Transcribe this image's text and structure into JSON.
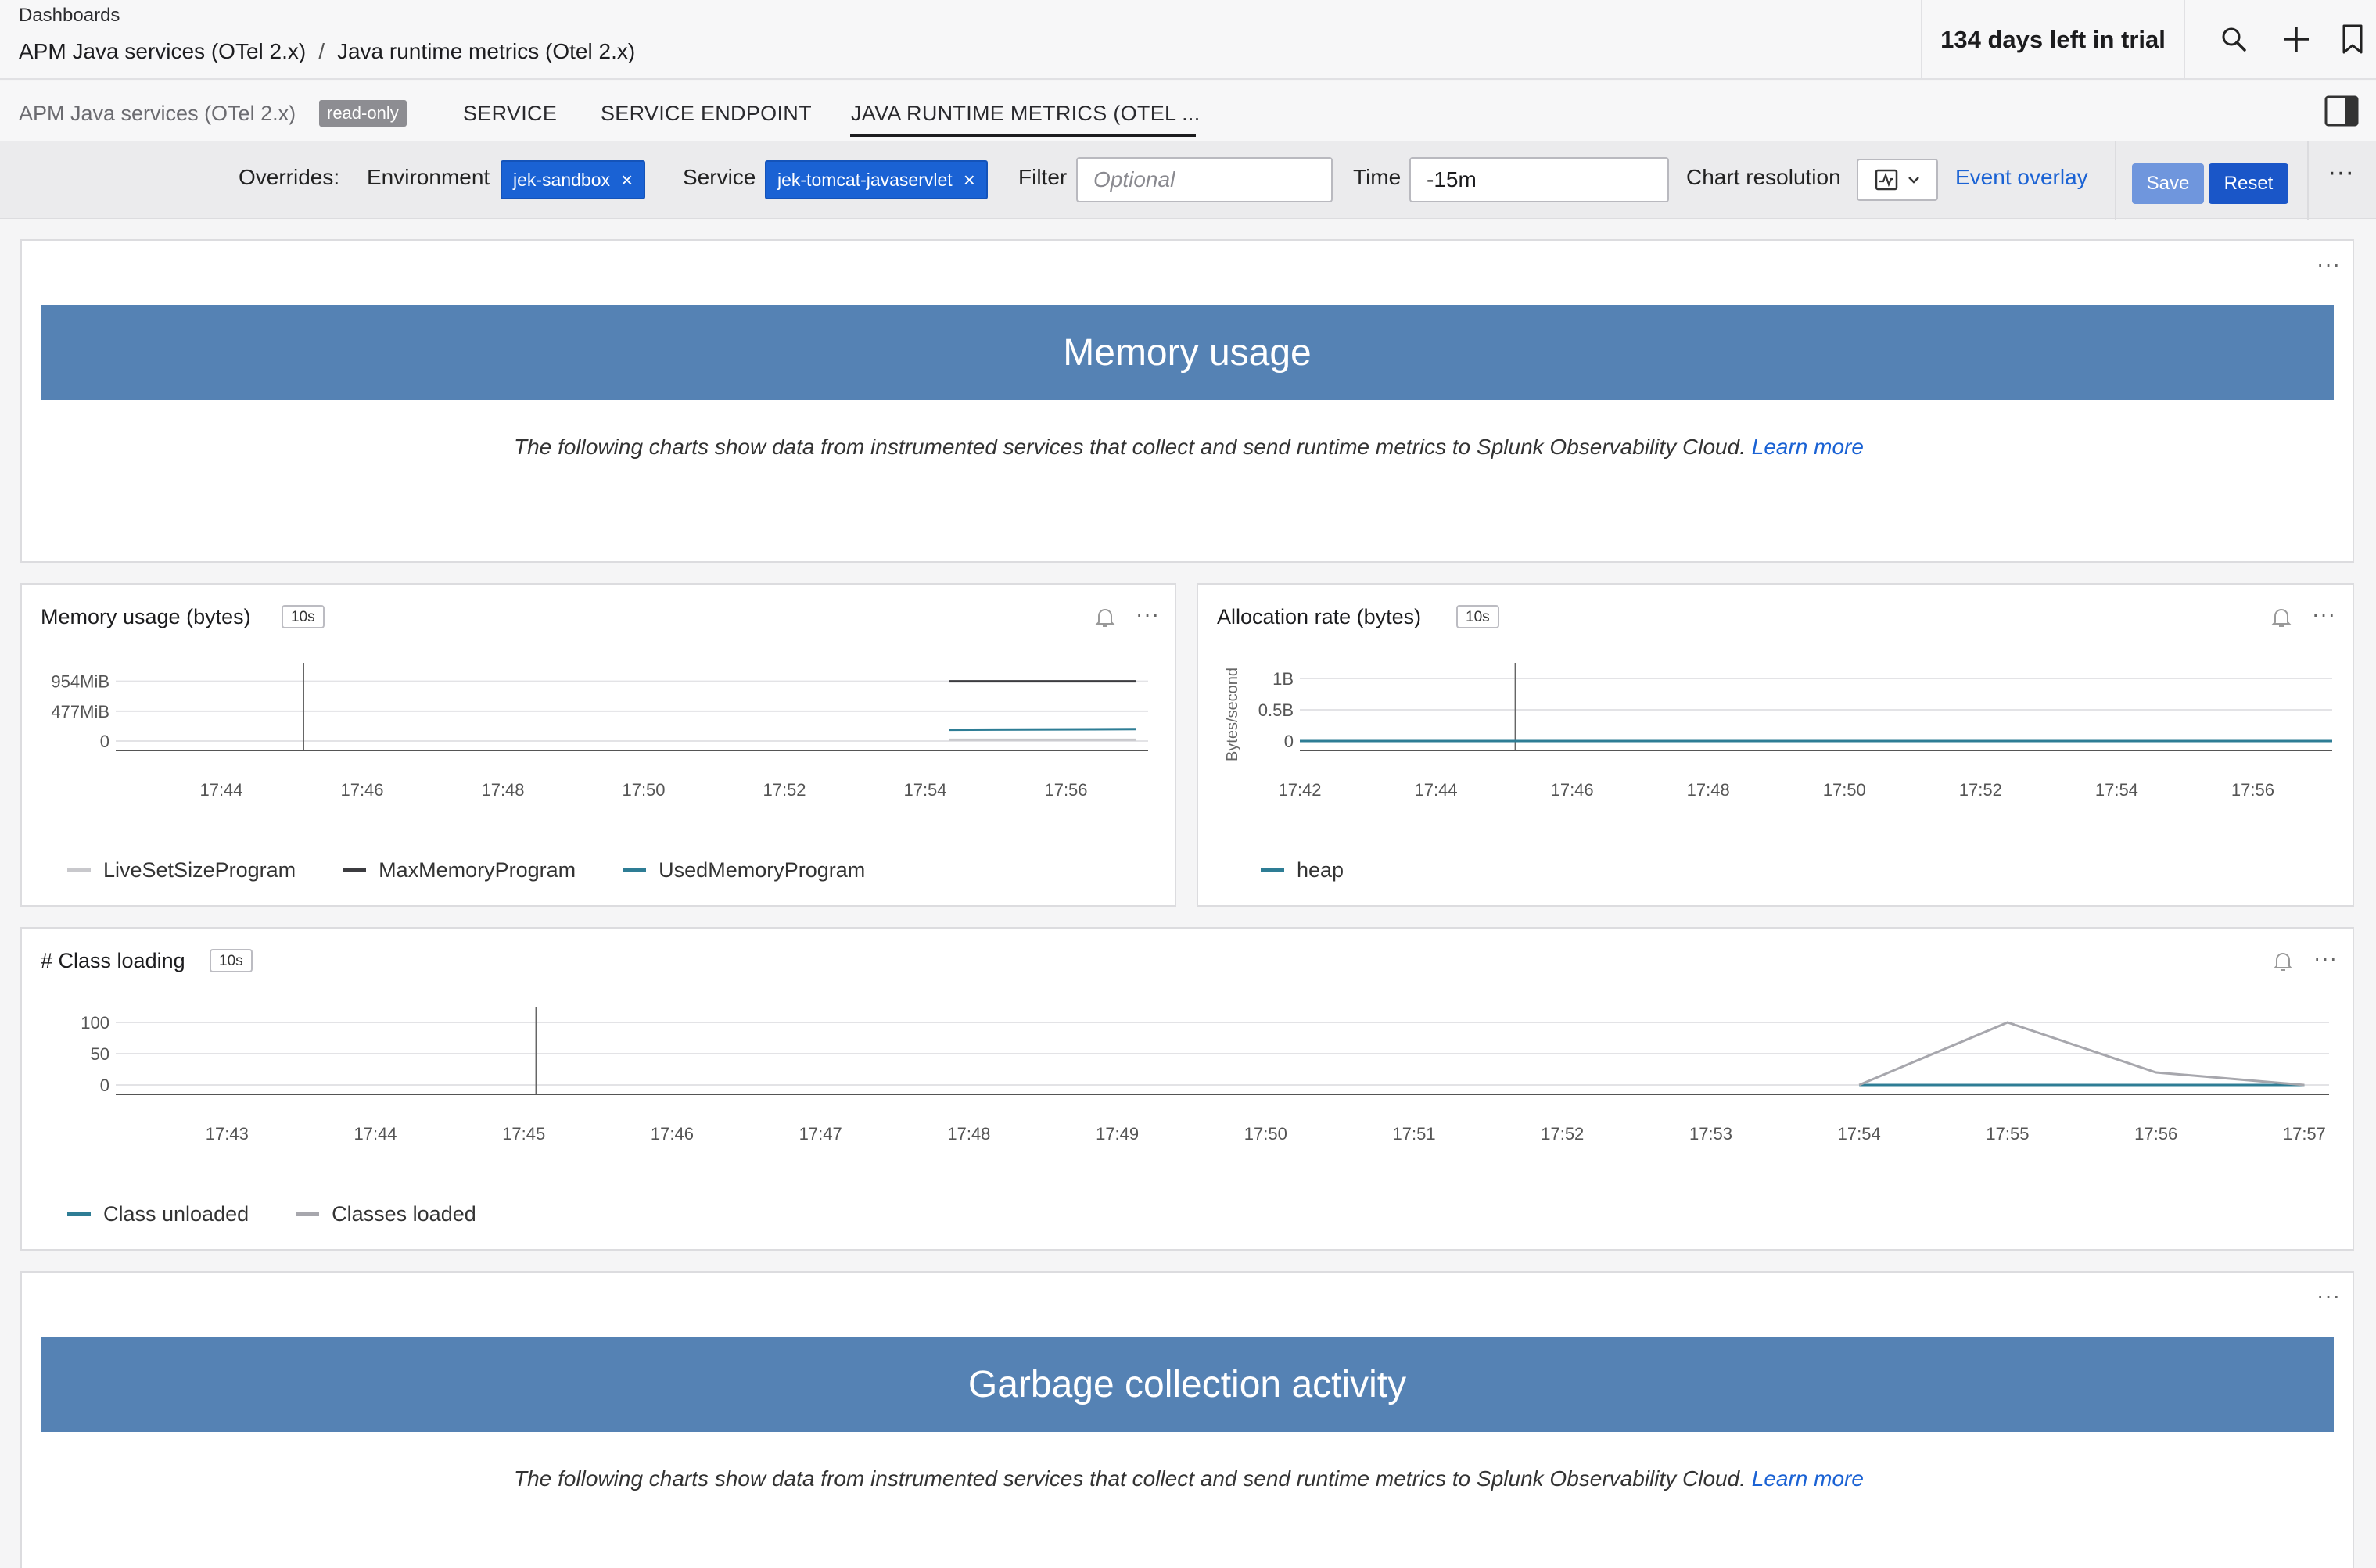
{
  "header": {
    "section_label": "Dashboards",
    "breadcrumb_group": "APM Java services (OTel 2.x)",
    "breadcrumb_separator": "/",
    "breadcrumb_current": "Java runtime metrics (Otel 2.x)",
    "trial_text": "134 days left in trial",
    "icons": [
      "search-icon",
      "plus-icon",
      "bookmark-icon"
    ]
  },
  "tabs": {
    "group_name": "APM Java services (OTel 2.x)",
    "read_only_badge": "read-only",
    "items": [
      "SERVICE",
      "SERVICE ENDPOINT",
      "JAVA RUNTIME METRICS (OTEL ..."
    ],
    "active_index": 2,
    "panel_toggle_icon": "sidebar-panel-icon"
  },
  "overrides": {
    "label": "Overrides:",
    "environment_label": "Environment",
    "environment_value": "jek-sandbox",
    "service_label": "Service",
    "service_value": "jek-tomcat-javaservlet",
    "filter_label": "Filter",
    "filter_placeholder": "Optional",
    "time_label": "Time",
    "time_value": "-15m",
    "chart_resolution_label": "Chart resolution",
    "event_overlay": "Event overlay",
    "save": "Save",
    "reset": "Reset",
    "more": "···"
  },
  "sections": {
    "memory": {
      "title": "Memory usage",
      "description": "The following charts show data from instrumented services that collect and send runtime metrics to Splunk Observability Cloud.",
      "link": "Learn more"
    },
    "gc": {
      "title": "Garbage collection activity",
      "description": "The following charts show data from instrumented services that collect and send runtime metrics to Splunk Observability Cloud.",
      "link": "Learn more"
    }
  },
  "charts": {
    "memory_usage": {
      "title": "Memory usage (bytes)",
      "resolution": "10s"
    },
    "allocation_rate": {
      "title": "Allocation rate (bytes)",
      "resolution": "10s"
    },
    "class_loading": {
      "title": "# Class loading",
      "resolution": "10s"
    }
  },
  "chart_data": [
    {
      "type": "line",
      "title": "Memory usage (bytes)",
      "ylabel": "",
      "y_ticks": [
        "0",
        "477MiB",
        "954MiB"
      ],
      "ylim": [
        0,
        1000
      ],
      "x_ticks": [
        "17:44",
        "17:46",
        "17:48",
        "17:50",
        "17:52",
        "17:54",
        "17:56"
      ],
      "xlim": [
        "17:42:30",
        "17:57:10"
      ],
      "event_marker": "17:45:10",
      "series": [
        {
          "name": "LiveSetSizeProgram",
          "color": "#c8c8cc",
          "points": [
            [
              "17:54:20",
              20
            ],
            [
              "17:57:00",
              20
            ]
          ]
        },
        {
          "name": "MaxMemoryProgram",
          "color": "#3c3c40",
          "points": [
            [
              "17:54:20",
              954
            ],
            [
              "17:57:00",
              954
            ]
          ]
        },
        {
          "name": "UsedMemoryProgram",
          "color": "#2e7d95",
          "points": [
            [
              "17:54:20",
              180
            ],
            [
              "17:57:00",
              190
            ]
          ]
        }
      ]
    },
    {
      "type": "line",
      "title": "Allocation rate (bytes)",
      "ylabel": "Bytes/second",
      "y_ticks": [
        "0",
        "0.5B",
        "1B"
      ],
      "ylim": [
        0,
        1
      ],
      "x_ticks": [
        "17:42",
        "17:44",
        "17:46",
        "17:48",
        "17:50",
        "17:52",
        "17:54",
        "17:56"
      ],
      "xlim": [
        "17:42",
        "17:57:10"
      ],
      "event_marker": "17:45:10",
      "series": [
        {
          "name": "heap",
          "color": "#2e7d95",
          "points": [
            [
              "17:42",
              0
            ],
            [
              "17:57:10",
              0
            ]
          ]
        }
      ]
    },
    {
      "type": "line",
      "title": "# Class loading",
      "ylabel": "",
      "y_ticks": [
        "0",
        "50",
        "100"
      ],
      "ylim": [
        0,
        100
      ],
      "x_ticks": [
        "17:43",
        "17:44",
        "17:45",
        "17:46",
        "17:47",
        "17:48",
        "17:49",
        "17:50",
        "17:51",
        "17:52",
        "17:53",
        "17:54",
        "17:55",
        "17:56",
        "17:57"
      ],
      "xlim": [
        "17:42:15",
        "17:57:10"
      ],
      "event_marker": "17:45:05",
      "series": [
        {
          "name": "Class unloaded",
          "color": "#2e7d95",
          "points": [
            [
              "17:54",
              0
            ],
            [
              "17:55",
              0
            ],
            [
              "17:56",
              0
            ],
            [
              "17:57",
              0
            ]
          ]
        },
        {
          "name": "Classes loaded",
          "color": "#a7a7ad",
          "points": [
            [
              "17:54",
              0
            ],
            [
              "17:55",
              100
            ],
            [
              "17:56",
              20
            ],
            [
              "17:57",
              0
            ]
          ]
        }
      ]
    }
  ]
}
